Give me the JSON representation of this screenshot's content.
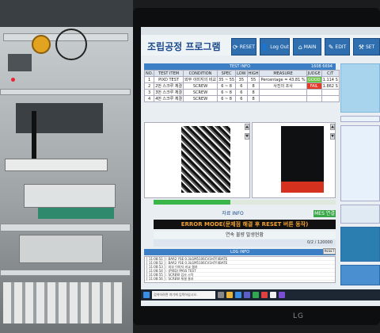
{
  "app": {
    "title": "조립공정 프로그램",
    "buttons": [
      {
        "label": "RESET",
        "icon": "refresh-icon"
      },
      {
        "label": "Log Out",
        "icon": "user-icon"
      },
      {
        "label": "MAIN",
        "icon": "home-icon"
      },
      {
        "label": "EDIT",
        "icon": "pencil-icon"
      },
      {
        "label": "SET",
        "icon": "wrench-icon"
      }
    ]
  },
  "test_info": {
    "header": "TEST INFO",
    "right_label": "1608   6694",
    "columns": [
      "NO.",
      "TEST ITEM",
      "CONDITION",
      "SPEC",
      "LOW",
      "HIGH",
      "MEASURE",
      "JUDGE",
      "C/T"
    ],
    "rows": [
      {
        "no": "1",
        "item": "PIXD TEST",
        "condition": "외부 이미지의 비교",
        "spec": "35 ~ 55",
        "low": "35",
        "high": "55",
        "measure": "Percentage = 43.81 %",
        "judge": "GOOD",
        "ct": "1.114 S"
      },
      {
        "no": "2",
        "item": "2번 스크루 체결",
        "condition": "SCREW",
        "spec": "6 ~ 8",
        "low": "6",
        "high": "8",
        "measure": "사진의 조사",
        "judge": "FAIL",
        "ct": "1.862 S"
      },
      {
        "no": "3",
        "item": "3번 스크루 체결",
        "condition": "SCREW",
        "spec": "6 ~ 8",
        "low": "6",
        "high": "8",
        "measure": "",
        "judge": "",
        "ct": ""
      },
      {
        "no": "4",
        "item": "4번 스크루 체결",
        "condition": "SCREW",
        "spec": "6 ~ 8",
        "low": "6",
        "high": "8",
        "measure": "",
        "judge": "",
        "ct": ""
      }
    ]
  },
  "status": {
    "data_label": "자료 INFO",
    "mes_badge": "MES 연결",
    "error_text": "ERROR MODE(문제점 해결 후 RESET 버튼 동작)",
    "progress_label": "연속 불량 발생현황",
    "count_text": "0/2 / 120000",
    "progress_value": 0.42
  },
  "log": {
    "header": "LOG INFO",
    "reset_label": "RESET",
    "lines": [
      "[ 11:08:51 ] : BAR2 YSE 0.3LGM5106CV1H7F4BATE",
      "[ 11:08:52 ] : BAR2 YSE 0.3LGM5106CV1H7F4BATE",
      "[ 11:08:53 ] : 외부 이미지 비교 결과",
      "[ 11:08:54 ] : (PIXD) PASS TEST",
      "[ 11:08:55 ] : SCREW 검사 시작",
      "[ 11:08:56 ] : SCREW 체결 결과"
    ]
  },
  "taskbar": {
    "search_placeholder": "검색하려면 여기에 입력하십시오."
  },
  "monitor_brand": "LG",
  "colors": {
    "accent": "#2f6fb0",
    "good": "#6cc24a",
    "fail": "#e23b2a",
    "error_text": "#f0a030"
  }
}
